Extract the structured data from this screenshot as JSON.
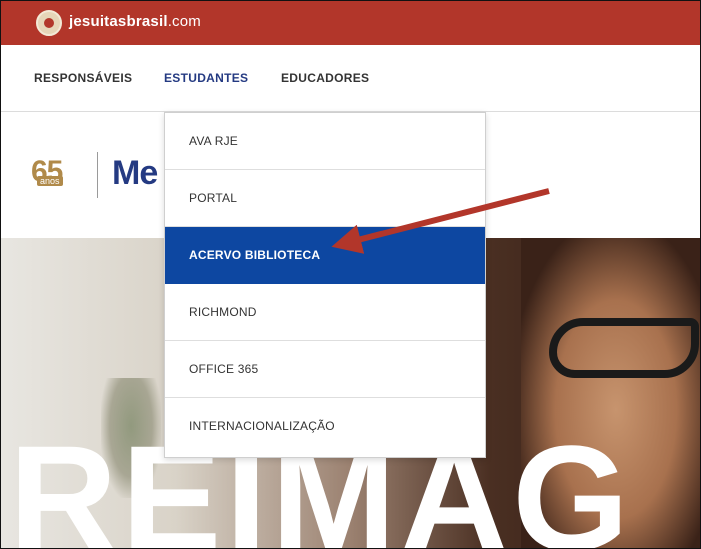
{
  "header": {
    "brand_bold": "jesuitasbrasil",
    "brand_suffix": ".com",
    "bar_color": "#b2362a"
  },
  "nav": {
    "items": [
      {
        "label": "RESPONSÁVEIS"
      },
      {
        "label": "ESTUDANTES"
      },
      {
        "label": "EDUCADORES"
      }
    ],
    "active": "ESTUDANTES"
  },
  "logo": {
    "number": "65",
    "anos": "anos",
    "word": "Me"
  },
  "dropdown": {
    "items": [
      {
        "label": "AVA RJE"
      },
      {
        "label": "PORTAL"
      },
      {
        "label": "ACERVO BIBLIOTECA"
      },
      {
        "label": "RICHMOND"
      },
      {
        "label": "OFFICE 365"
      },
      {
        "label": "INTERNACIONALIZAÇÃO"
      }
    ],
    "selected": "ACERVO BIBLIOTECA",
    "selected_color": "#0d47a1"
  },
  "hero": {
    "text": "REIMAG"
  },
  "annotation": {
    "arrow_color": "#b2362a",
    "arrow_target": "ACERVO BIBLIOTECA"
  }
}
